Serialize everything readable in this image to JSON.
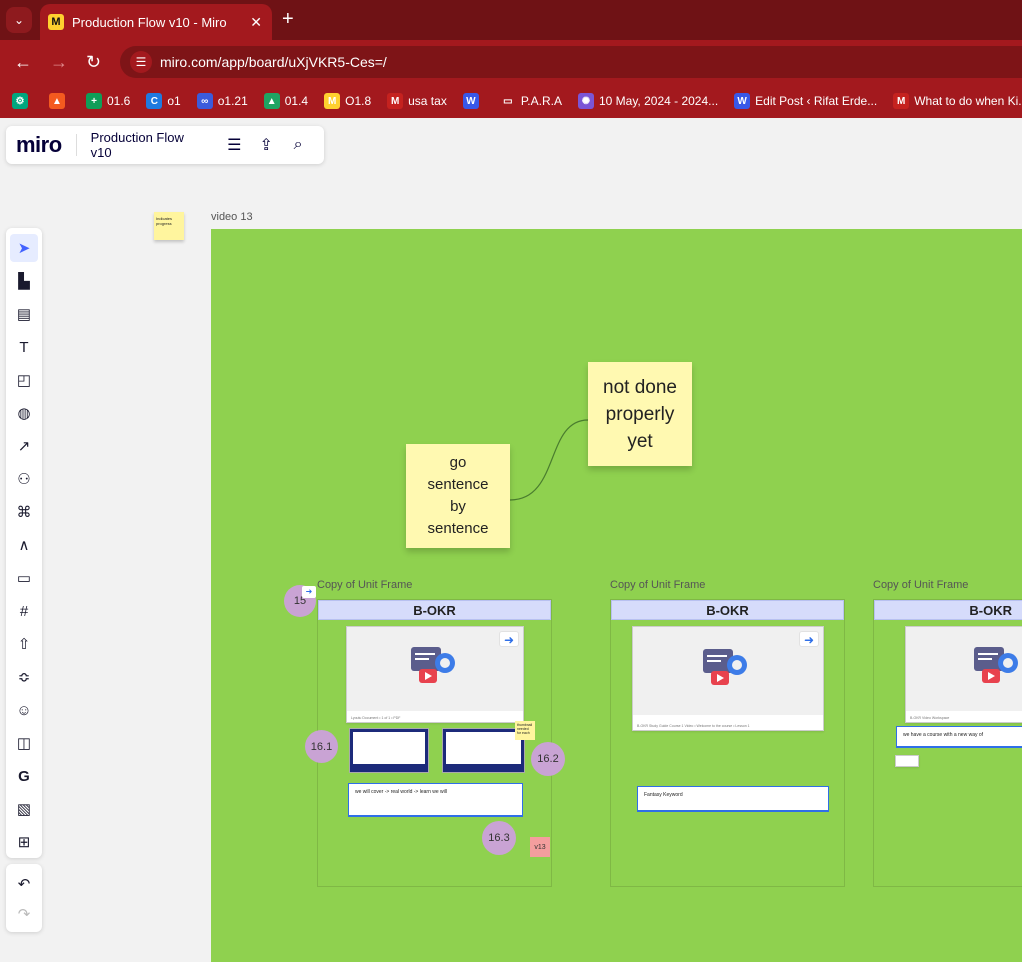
{
  "browser": {
    "tab_title": "Production Flow v10 - Miro",
    "tab_fav": "M",
    "url": "miro.com/app/board/uXjVKR5-Ces=/",
    "bookmarks": [
      {
        "label": "",
        "color": "#00a67e",
        "glyph": "⚙"
      },
      {
        "label": "",
        "color": "#f45a1f",
        "glyph": "▲"
      },
      {
        "label": "01.6",
        "color": "#0f9d58",
        "glyph": "+"
      },
      {
        "label": "o1",
        "color": "#1f7ae0",
        "glyph": "C"
      },
      {
        "label": "o1.21",
        "color": "#3b5bdb",
        "glyph": "∞"
      },
      {
        "label": "01.4",
        "color": "#1fa463",
        "glyph": "▲"
      },
      {
        "label": "O1.8",
        "color": "#ffd02f",
        "glyph": "M"
      },
      {
        "label": "usa tax",
        "color": "#c5221f",
        "glyph": "M"
      },
      {
        "label": "",
        "color": "#3858e9",
        "glyph": "W"
      },
      {
        "label": "P.A.R.A",
        "color": "transparent",
        "glyph": "▭"
      },
      {
        "label": "10 May, 2024 - 2024...",
        "color": "#7b55d6",
        "glyph": "✺"
      },
      {
        "label": "Edit Post ‹ Rifat Erde...",
        "color": "#3858e9",
        "glyph": "W"
      },
      {
        "label": "What to do when Ki...",
        "color": "#c5221f",
        "glyph": "M"
      }
    ]
  },
  "miro": {
    "logo": "miro",
    "board_name": "Production Flow v10",
    "tools": [
      "select-tool",
      "templates-tool",
      "frame-layout-tool",
      "text-tool",
      "sticky-note-tool",
      "shapes-tool",
      "connection-line-tool",
      "diagramming-tool",
      "mind-map-tool",
      "pen-tool",
      "comment-tool",
      "frame-tool",
      "upload-tool",
      "integrations-tool",
      "stickers-tool",
      "embed-tool",
      "google-tool",
      "image-tool",
      "more-apps-tool"
    ]
  },
  "canvas": {
    "mini_sticky_text": "Indicates progress",
    "frame_title": "video 13",
    "sticky_left": "go sentence by sentence",
    "sticky_right": "not done properly yet",
    "unit_frames": [
      {
        "title": "Copy of Unit Frame",
        "okr": "B-OKR",
        "textbox": "we will cover -> real world -> learn we will",
        "card_meta": "Lyoutu Document • 1 of 1 • PDF"
      },
      {
        "title": "Copy of Unit Frame",
        "okr": "B-OKR",
        "textbox": "Fantasy Keyword",
        "card_meta": "B-OKR Study Guide Course 1 Video • Welcome to the course • Lesson 1"
      },
      {
        "title": "Copy of Unit Frame",
        "okr": "B-OKR",
        "textbox": "we have a course with a new way of",
        "card_meta": "B-OKR Video Workspace"
      }
    ],
    "circles": [
      "15",
      "16.1",
      "16.2",
      "16.3"
    ],
    "tag": "v13",
    "small_note": "thumbnail needed for each"
  }
}
